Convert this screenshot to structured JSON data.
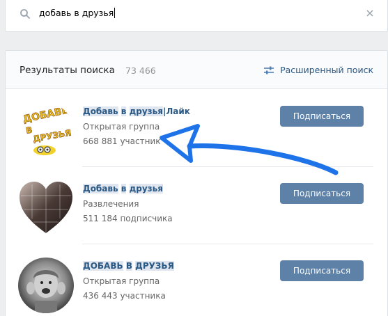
{
  "search": {
    "query": "добавь в друзья",
    "icon": "search-icon",
    "clear_icon": "close-icon"
  },
  "results": {
    "title": "Результаты поиска",
    "count": "73 466",
    "advanced_label": "Расширенный поиск",
    "advanced_icon": "filter-sliders-icon"
  },
  "items": [
    {
      "name_parts": [
        "Добавь",
        " ",
        "в",
        " ",
        "друзья",
        "|Лайк"
      ],
      "category": "Открытая группа",
      "members": "668 881 участник",
      "button": "Подписаться",
      "avatar_text": [
        "ДОБАВЬ",
        "В",
        "ДРУЗЬЯ"
      ]
    },
    {
      "name_parts": [
        "Добавь",
        " ",
        "в",
        " ",
        "друзья",
        ""
      ],
      "category": "Развлечения",
      "members": "511 184 подписчика",
      "button": "Подписаться"
    },
    {
      "name_parts": [
        "ДОБАВЬ",
        " ",
        "В",
        " ",
        "ДРУЗЬЯ",
        ""
      ],
      "category": "Открытая группа",
      "members": "436 443 участника",
      "button": "Подписаться"
    }
  ],
  "colors": {
    "link": "#2a5885",
    "button": "#5e81a8",
    "arrow": "#1e73e8",
    "background": "#edeef0"
  }
}
